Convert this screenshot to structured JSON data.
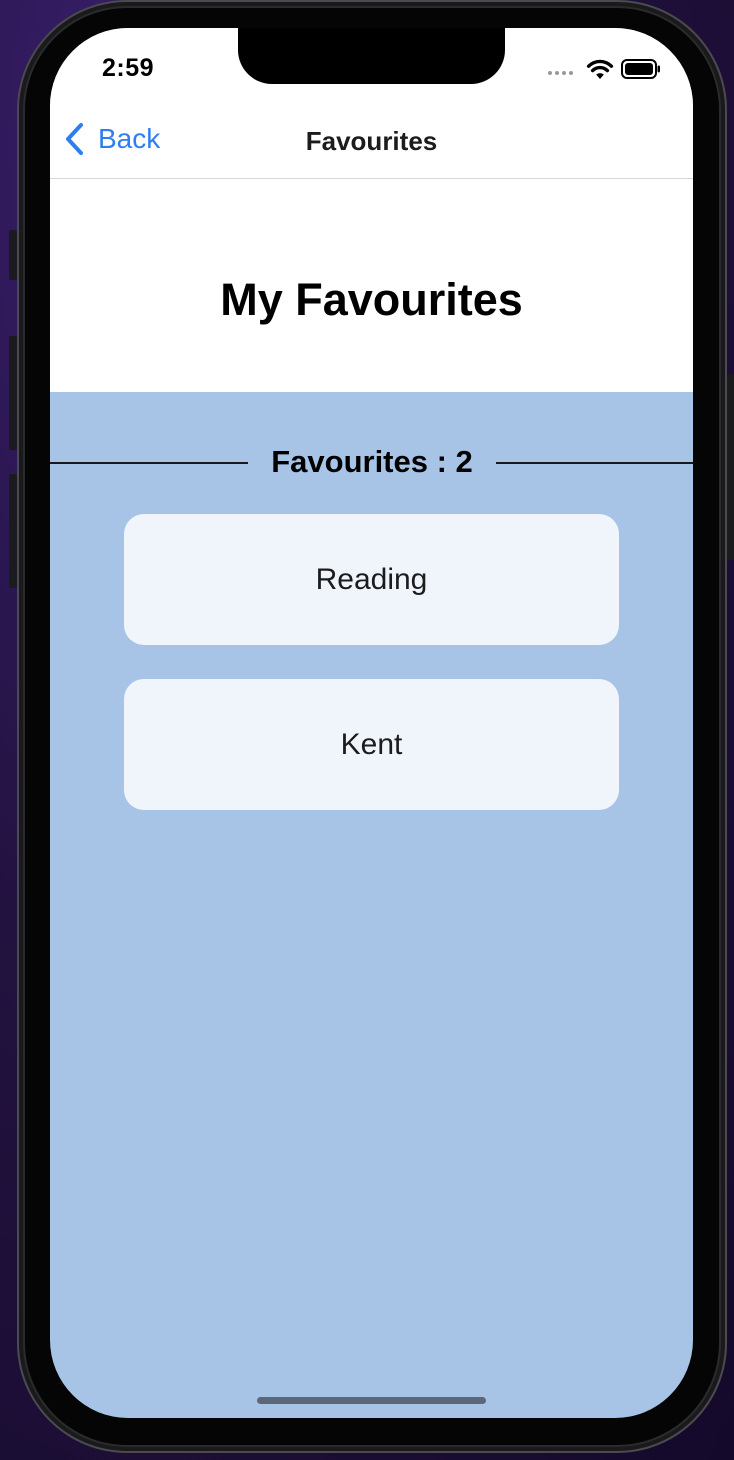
{
  "status_bar": {
    "time": "2:59"
  },
  "nav": {
    "back_label": "Back",
    "title": "Favourites"
  },
  "page": {
    "heading": "My Favourites",
    "count_label": "Favourites : 2"
  },
  "favourites": [
    {
      "label": "Reading"
    },
    {
      "label": "Kent"
    }
  ],
  "colors": {
    "accent": "#2f7ef0",
    "content_background": "#a7c4e6",
    "card_background": "#f0f4fb"
  },
  "icons": [
    "chevron-left-icon",
    "wifi-icon",
    "battery-icon",
    "cellular-signal-icon"
  ]
}
